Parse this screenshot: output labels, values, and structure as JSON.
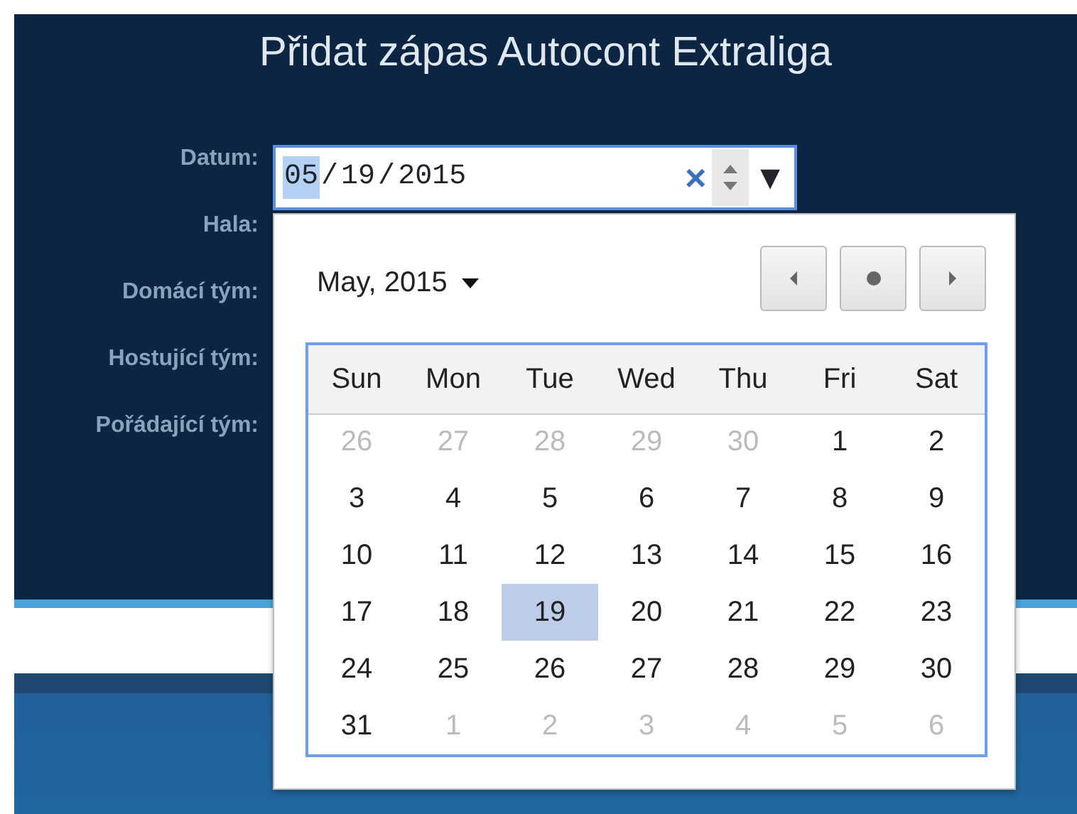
{
  "title": "Přidat zápas Autocont Extraliga",
  "fields": [
    {
      "label": "Datum:"
    },
    {
      "label": "Hala:"
    },
    {
      "label": "Domácí tým:"
    },
    {
      "label": "Hostující tým:"
    },
    {
      "label": "Pořádající tým:"
    }
  ],
  "date_input": {
    "segments": [
      {
        "text": "05",
        "selected": true
      },
      {
        "text": "/",
        "selected": false
      },
      {
        "text": "19",
        "selected": false
      },
      {
        "text": "/",
        "selected": false
      },
      {
        "text": "2015",
        "selected": false
      }
    ],
    "clear": "×",
    "dropdown": "▼"
  },
  "calendar": {
    "month": "May, 2015",
    "weekdays": [
      "Sun",
      "Mon",
      "Tue",
      "Wed",
      "Thu",
      "Fri",
      "Sat"
    ],
    "weeks": [
      [
        {
          "day": "26",
          "outside": true,
          "selected": false
        },
        {
          "day": "27",
          "outside": true,
          "selected": false
        },
        {
          "day": "28",
          "outside": true,
          "selected": false
        },
        {
          "day": "29",
          "outside": true,
          "selected": false
        },
        {
          "day": "30",
          "outside": true,
          "selected": false
        },
        {
          "day": "1",
          "outside": false,
          "selected": false
        },
        {
          "day": "2",
          "outside": false,
          "selected": false
        }
      ],
      [
        {
          "day": "3",
          "outside": false,
          "selected": false
        },
        {
          "day": "4",
          "outside": false,
          "selected": false
        },
        {
          "day": "5",
          "outside": false,
          "selected": false
        },
        {
          "day": "6",
          "outside": false,
          "selected": false
        },
        {
          "day": "7",
          "outside": false,
          "selected": false
        },
        {
          "day": "8",
          "outside": false,
          "selected": false
        },
        {
          "day": "9",
          "outside": false,
          "selected": false
        }
      ],
      [
        {
          "day": "10",
          "outside": false,
          "selected": false
        },
        {
          "day": "11",
          "outside": false,
          "selected": false
        },
        {
          "day": "12",
          "outside": false,
          "selected": false
        },
        {
          "day": "13",
          "outside": false,
          "selected": false
        },
        {
          "day": "14",
          "outside": false,
          "selected": false
        },
        {
          "day": "15",
          "outside": false,
          "selected": false
        },
        {
          "day": "16",
          "outside": false,
          "selected": false
        }
      ],
      [
        {
          "day": "17",
          "outside": false,
          "selected": false
        },
        {
          "day": "18",
          "outside": false,
          "selected": false
        },
        {
          "day": "19",
          "outside": false,
          "selected": true
        },
        {
          "day": "20",
          "outside": false,
          "selected": false
        },
        {
          "day": "21",
          "outside": false,
          "selected": false
        },
        {
          "day": "22",
          "outside": false,
          "selected": false
        },
        {
          "day": "23",
          "outside": false,
          "selected": false
        }
      ],
      [
        {
          "day": "24",
          "outside": false,
          "selected": false
        },
        {
          "day": "25",
          "outside": false,
          "selected": false
        },
        {
          "day": "26",
          "outside": false,
          "selected": false
        },
        {
          "day": "27",
          "outside": false,
          "selected": false
        },
        {
          "day": "28",
          "outside": false,
          "selected": false
        },
        {
          "day": "29",
          "outside": false,
          "selected": false
        },
        {
          "day": "30",
          "outside": false,
          "selected": false
        }
      ],
      [
        {
          "day": "31",
          "outside": false,
          "selected": false
        },
        {
          "day": "1",
          "outside": true,
          "selected": false
        },
        {
          "day": "2",
          "outside": true,
          "selected": false
        },
        {
          "day": "3",
          "outside": true,
          "selected": false
        },
        {
          "day": "4",
          "outside": true,
          "selected": false
        },
        {
          "day": "5",
          "outside": true,
          "selected": false
        },
        {
          "day": "6",
          "outside": true,
          "selected": false
        }
      ]
    ]
  }
}
